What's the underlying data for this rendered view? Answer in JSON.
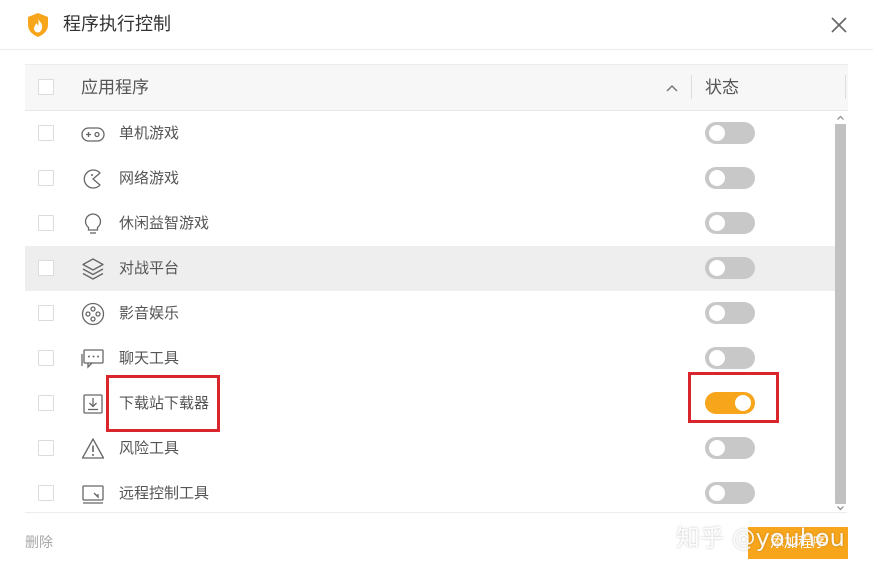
{
  "window": {
    "title": "程序执行控制",
    "logo_icon": "flame-shield-logo",
    "close_icon": "close-icon"
  },
  "table": {
    "header": {
      "app_column": "应用程序",
      "status_column": "状态",
      "sort_icon": "chevron-up-icon"
    },
    "rows": [
      {
        "label": "单机游戏",
        "icon": "gamepad-icon",
        "enabled": false,
        "highlighted": false
      },
      {
        "label": "网络游戏",
        "icon": "pacman-icon",
        "enabled": false,
        "highlighted": false
      },
      {
        "label": "休闲益智游戏",
        "icon": "lightbulb-icon",
        "enabled": false,
        "highlighted": false
      },
      {
        "label": "对战平台",
        "icon": "layers-icon",
        "enabled": false,
        "highlighted": true
      },
      {
        "label": "影音娱乐",
        "icon": "film-reel-icon",
        "enabled": false,
        "highlighted": false
      },
      {
        "label": "聊天工具",
        "icon": "chat-bubble-icon",
        "enabled": false,
        "highlighted": false
      },
      {
        "label": "下载站下载器",
        "icon": "download-icon",
        "enabled": true,
        "highlighted": false
      },
      {
        "label": "风险工具",
        "icon": "warning-icon",
        "enabled": false,
        "highlighted": false
      },
      {
        "label": "远程控制工具",
        "icon": "remote-screen-icon",
        "enabled": false,
        "highlighted": false
      }
    ]
  },
  "footer": {
    "delete_label": "删除",
    "add_button_label": "添加程序"
  },
  "watermark": "知乎 @youhou",
  "colors": {
    "accent": "#f7a51b",
    "toggle_off": "#c8c8c8",
    "highlight_row": "#eeeeee",
    "annotation_red": "#d9262d"
  }
}
